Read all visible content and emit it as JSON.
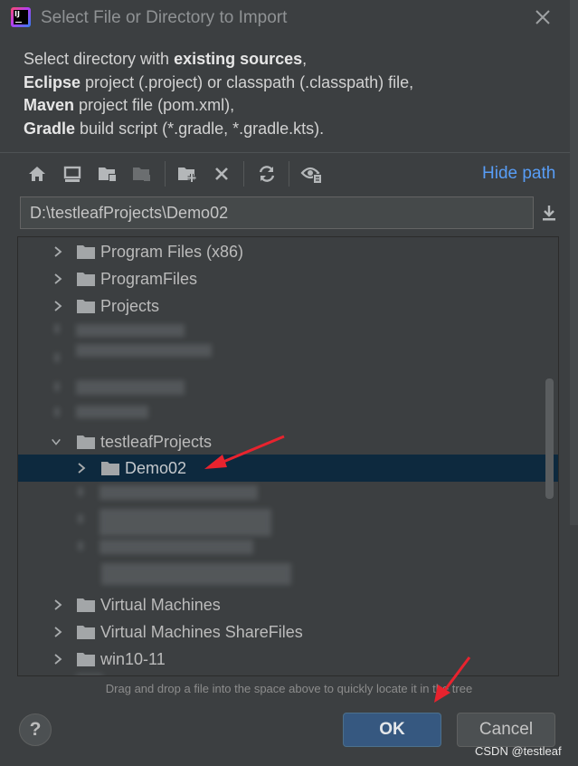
{
  "window": {
    "title": "Select File or Directory to Import"
  },
  "description": {
    "line1_pre": "Select directory with ",
    "line1_bold": "existing sources",
    "line1_post": ",",
    "line2_bold": "Eclipse",
    "line2_post": " project (.project) or classpath (.classpath) file,",
    "line3_bold": "Maven",
    "line3_post": " project file (pom.xml),",
    "line4_bold": "Gradle",
    "line4_post": " build script (*.gradle, *.gradle.kts)."
  },
  "toolbar": {
    "icons": [
      "home-icon",
      "desktop-icon",
      "project-folder-icon",
      "module-folder-icon",
      "new-folder-icon",
      "delete-icon",
      "refresh-icon",
      "show-hidden-icon"
    ],
    "hide_path_label": "Hide path"
  },
  "path": {
    "value": "D:\\testleafProjects\\Demo02"
  },
  "tree": {
    "items": [
      {
        "label": "Program Files (x86)",
        "expanded": false
      },
      {
        "label": "ProgramFiles",
        "expanded": false
      },
      {
        "label": "Projects",
        "expanded": false
      },
      {
        "label": "testleafProjects",
        "expanded": true
      },
      {
        "label": "Demo02",
        "expanded": false,
        "selected": true
      },
      {
        "label": "Virtual Machines",
        "expanded": false
      },
      {
        "label": "Virtual Machines ShareFiles",
        "expanded": false
      },
      {
        "label": "win10-11",
        "expanded": false
      }
    ]
  },
  "hint": {
    "drag_text": "Drag and drop a file into the space above to quickly locate it in the tree"
  },
  "buttons": {
    "help": "?",
    "ok": "OK",
    "cancel": "Cancel"
  },
  "watermark": "CSDN @testleaf",
  "colors": {
    "background": "#3c3f41",
    "accent_link": "#589df6",
    "selection": "#0d293e",
    "ok_button": "#365880",
    "annotation_arrow": "#e8232e"
  }
}
